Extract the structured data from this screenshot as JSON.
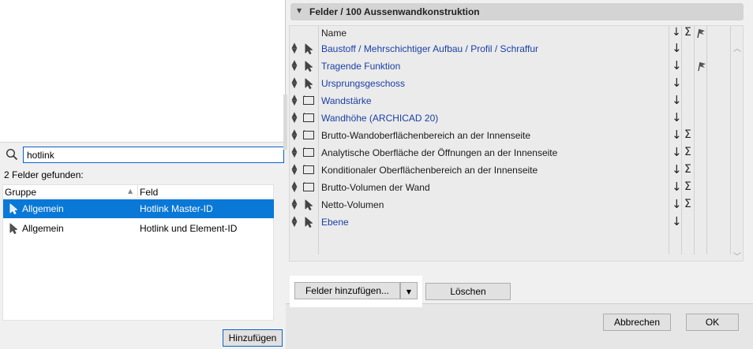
{
  "dialog": {
    "section_title": "Felder / 100 Aussenwandkonstruktion",
    "column_name": "Name",
    "header_icons": {
      "sort": "↓",
      "sum": "Σ",
      "flag": "flag-icon"
    },
    "fields": [
      {
        "label": "Baustoff / Mehrschichtiger Aufbau / Profil / Schraffur",
        "icon": "pointer-icon",
        "color": "blue",
        "sort": "↓",
        "sum": "",
        "flag": false
      },
      {
        "label": "Tragende Funktion",
        "icon": "pointer-icon",
        "color": "blue",
        "sort": "↓",
        "sum": "",
        "flag": true
      },
      {
        "label": "Ursprungsgeschoss",
        "icon": "pointer-icon",
        "color": "blue",
        "sort": "↓",
        "sum": "",
        "flag": false
      },
      {
        "label": "Wandstärke",
        "icon": "box-icon",
        "color": "blue",
        "sort": "↓",
        "sum": "",
        "flag": false
      },
      {
        "label": "Wandhöhe (ARCHICAD 20)",
        "icon": "box-icon",
        "color": "blue",
        "sort": "↓",
        "sum": "",
        "flag": false
      },
      {
        "label": "Brutto-Wandoberflächenbereich an der Innenseite",
        "icon": "box-icon",
        "color": "black",
        "sort": "↓",
        "sum": "Σ",
        "flag": false
      },
      {
        "label": "Analytische Oberfläche der Öffnungen an der Innenseite",
        "icon": "box-icon",
        "color": "black",
        "sort": "↓",
        "sum": "Σ",
        "flag": false
      },
      {
        "label": "Konditionaler Oberflächenbereich an der Innenseite",
        "icon": "box-icon",
        "color": "black",
        "sort": "↓",
        "sum": "Σ",
        "flag": false
      },
      {
        "label": "Brutto-Volumen der Wand",
        "icon": "box-icon",
        "color": "black",
        "sort": "↓",
        "sum": "Σ",
        "flag": false
      },
      {
        "label": "Netto-Volumen",
        "icon": "pointer-icon",
        "color": "black",
        "sort": "↓",
        "sum": "Σ",
        "flag": false
      },
      {
        "label": "Ebene",
        "icon": "pointer-icon",
        "color": "blue",
        "sort": "↓",
        "sum": "",
        "flag": false
      }
    ],
    "add_fields_label": "Felder hinzufügen...",
    "delete_label": "Löschen",
    "cancel_label": "Abbrechen",
    "ok_label": "OK"
  },
  "search": {
    "value": "hotlink",
    "found_text": "2 Felder gefunden:",
    "col_group": "Gruppe",
    "col_field": "Feld",
    "results": [
      {
        "group": "Allgemein",
        "field": "Hotlink Master-ID",
        "selected": true
      },
      {
        "group": "Allgemein",
        "field": "Hotlink und Element-ID",
        "selected": false
      }
    ],
    "add_label": "Hinzufügen"
  },
  "colors": {
    "link_blue": "#1a3fa6",
    "selection": "#0a78d7",
    "focus_border": "#0a64c8"
  }
}
